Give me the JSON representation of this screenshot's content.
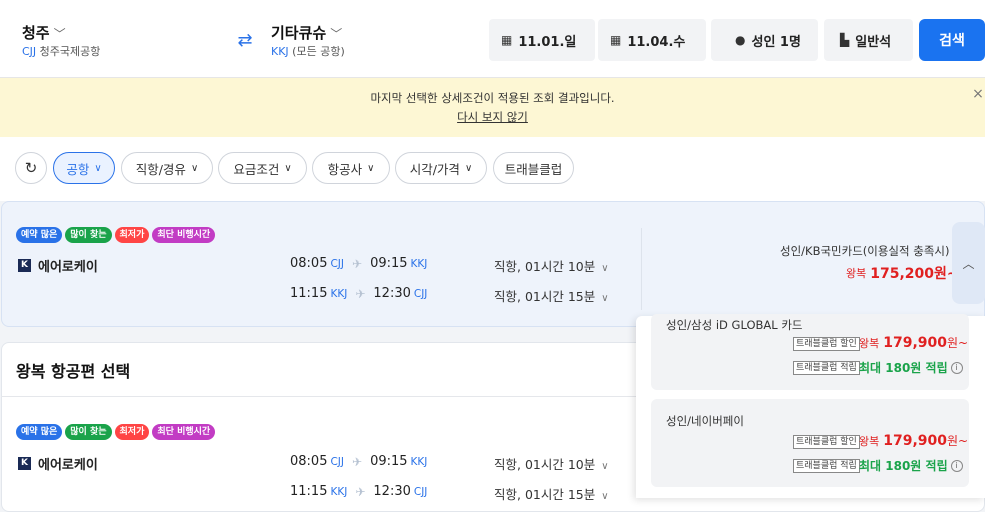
{
  "header": {
    "from": {
      "city": "청주",
      "code": "CJJ",
      "name": "청주국제공항"
    },
    "to": {
      "city": "기타큐슈",
      "code": "KKJ",
      "name": "(모든 공항)"
    },
    "depart_date": "11.01.일",
    "return_date": "11.04.수",
    "passengers": "성인 1명",
    "cabin": "일반석",
    "search_label": "검색"
  },
  "notice": {
    "message": "마지막 선택한 상세조건이 적용된 조회 결과입니다.",
    "dismiss": "다시 보지 않기"
  },
  "filters": [
    "공항",
    "직항/경유",
    "요금조건",
    "항공사",
    "시각/가격",
    "트래블클럽"
  ],
  "badges": {
    "b1": "예약 많은",
    "b2": "많이 찾는",
    "b3": "최저가",
    "b4": "최단 비행시간"
  },
  "flight1": {
    "airline": "에어로케이",
    "out": {
      "dep": "08:05",
      "dep_ap": "CJJ",
      "arr": "09:15",
      "arr_ap": "KKJ",
      "dur": "직항, 01시간 10분"
    },
    "ret": {
      "dep": "11:15",
      "dep_ap": "KKJ",
      "arr": "12:30",
      "arr_ap": "CJJ",
      "dur": "직항, 01시간 15분"
    },
    "card": "성인/KB국민카드(이용실적 충족시)",
    "price_prefix": "왕복",
    "price": "175,200원~"
  },
  "section_title": "왕복 항공편 선택",
  "flight2": {
    "airline": "에어로케이",
    "out": {
      "dep": "08:05",
      "dep_ap": "CJJ",
      "arr": "09:15",
      "arr_ap": "KKJ",
      "dur": "직항, 01시간 10분"
    },
    "ret": {
      "dep": "11:15",
      "dep_ap": "KKJ",
      "arr": "12:30",
      "arr_ap": "CJJ",
      "dur": "직항, 01시간 15분"
    }
  },
  "offers": [
    {
      "name": "성인/삼성 iD GLOBAL 카드",
      "tag_discount": "트래블클럽 할인",
      "price_prefix": "왕복",
      "price": "179,900",
      "price_suffix": "원~",
      "tag_reward": "트래블클럽 적립",
      "reward": "최대 180원 적립"
    },
    {
      "name": "성인/네이버페이",
      "tag_discount": "트래블클럽 할인",
      "price_prefix": "왕복",
      "price": "179,900",
      "price_suffix": "원~",
      "tag_reward": "트래블클럽 적립",
      "reward": "최대 180원 적립"
    }
  ]
}
